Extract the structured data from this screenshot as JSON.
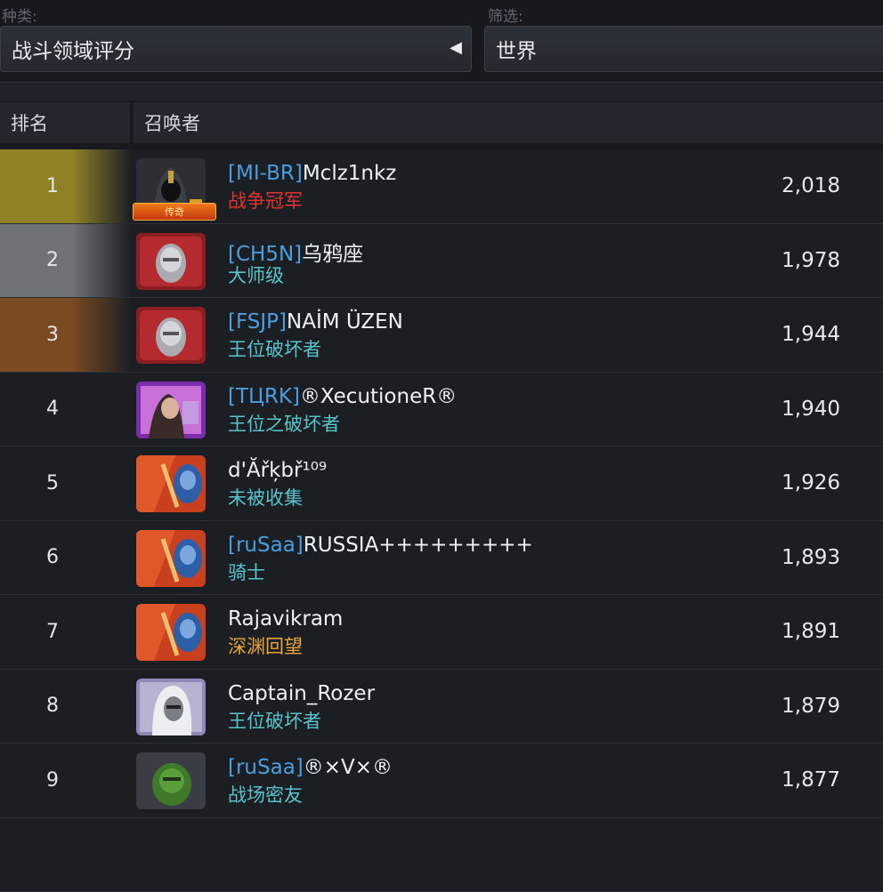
{
  "filters": {
    "type_label": "种类:",
    "type_value": "战斗领域评分",
    "filter_label": "筛选:",
    "filter_value": "世界"
  },
  "table": {
    "headers": {
      "rank": "排名",
      "summoner": "召唤者"
    },
    "rows": [
      {
        "rank": "1",
        "tag": "[MI-BR]",
        "name": "Mclz1nkz",
        "title": "战争冠军",
        "title_color": "#e0332e",
        "score": "2,018",
        "badge": "传奇",
        "avatar_icon": "hooded-hero-avatar-icon"
      },
      {
        "rank": "2",
        "tag": "[CH5N]",
        "name": "乌鸦座",
        "title": "大师级",
        "title_color": "#59c4c9",
        "score": "1,978",
        "avatar_icon": "silver-hero-avatar-icon"
      },
      {
        "rank": "3",
        "tag": "[FSJP]",
        "name": "NAİM ÜZEN",
        "title": "王位破坏者",
        "title_color": "#59c4c9",
        "score": "1,944",
        "avatar_icon": "silver-hero-avatar-icon"
      },
      {
        "rank": "4",
        "tag": "[TЦRK]",
        "name": "®XecutioneR®",
        "title": "王位之破坏者",
        "title_color": "#59c4c9",
        "score": "1,940",
        "avatar_icon": "purple-hero-avatar-icon"
      },
      {
        "rank": "5",
        "tag": "",
        "name": "d'Ăřķbř¹⁰⁹",
        "title": "未被收集",
        "title_color": "#59c4c9",
        "score": "1,926",
        "avatar_icon": "red-blue-hero-avatar-icon"
      },
      {
        "rank": "6",
        "tag": "[ruSaa]",
        "name": "RUSSIA+++++++++",
        "title": "骑士",
        "title_color": "#59c4c9",
        "score": "1,893",
        "avatar_icon": "red-blue-hero-avatar-icon"
      },
      {
        "rank": "7",
        "tag": "",
        "name": "Rajavikram",
        "title": "深渊回望",
        "title_color": "#e8a53a",
        "score": "1,891",
        "avatar_icon": "red-blue-hero-avatar-icon"
      },
      {
        "rank": "8",
        "tag": "",
        "name": "Captain_Rozer",
        "title": "王位破坏者",
        "title_color": "#59c4c9",
        "score": "1,879",
        "avatar_icon": "white-hair-hero-avatar-icon"
      },
      {
        "rank": "9",
        "tag": "[ruSaa]",
        "name": "®×V×®",
        "title": "战场密友",
        "title_color": "#59c4c9",
        "score": "1,877",
        "avatar_icon": "green-hero-avatar-icon"
      }
    ]
  },
  "colors": {
    "rank1": "#8f8226",
    "rank2": "#6f7378",
    "rank3": "#7a4a22",
    "tag": "#4a9fe0"
  }
}
